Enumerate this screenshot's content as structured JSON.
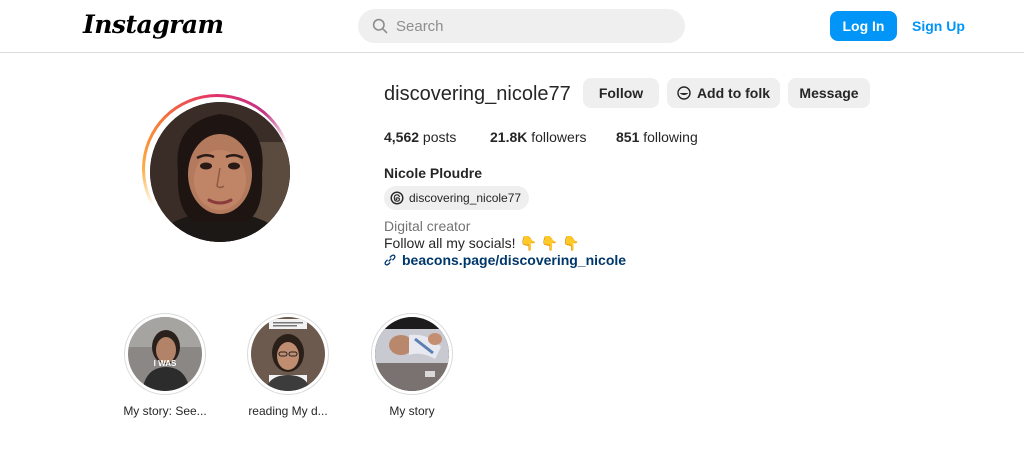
{
  "header": {
    "logo": "Instagram",
    "search_placeholder": "Search",
    "login_label": "Log In",
    "signup_label": "Sign Up",
    "accent_color": "#0095f6"
  },
  "profile": {
    "username": "discovering_nicole77",
    "buttons": {
      "follow": "Follow",
      "add_to_folk": "Add to folk",
      "message": "Message"
    },
    "stats": {
      "posts_count": "4,562",
      "posts_label": " posts",
      "followers_count": "21.8K",
      "followers_label": " followers",
      "following_count": "851",
      "following_label": " following"
    },
    "full_name": "Nicole Ploudre",
    "threads_handle": "discovering_nicole77",
    "category": "Digital creator",
    "bio": "Follow all my socials!",
    "bio_emoji": "👇 👇 👇",
    "link": "beacons.page/discovering_nicole"
  },
  "highlights": [
    {
      "label": "My story: See...",
      "overlay_text": "I WAS"
    },
    {
      "label": "reading My d..."
    },
    {
      "label": "My story"
    }
  ]
}
